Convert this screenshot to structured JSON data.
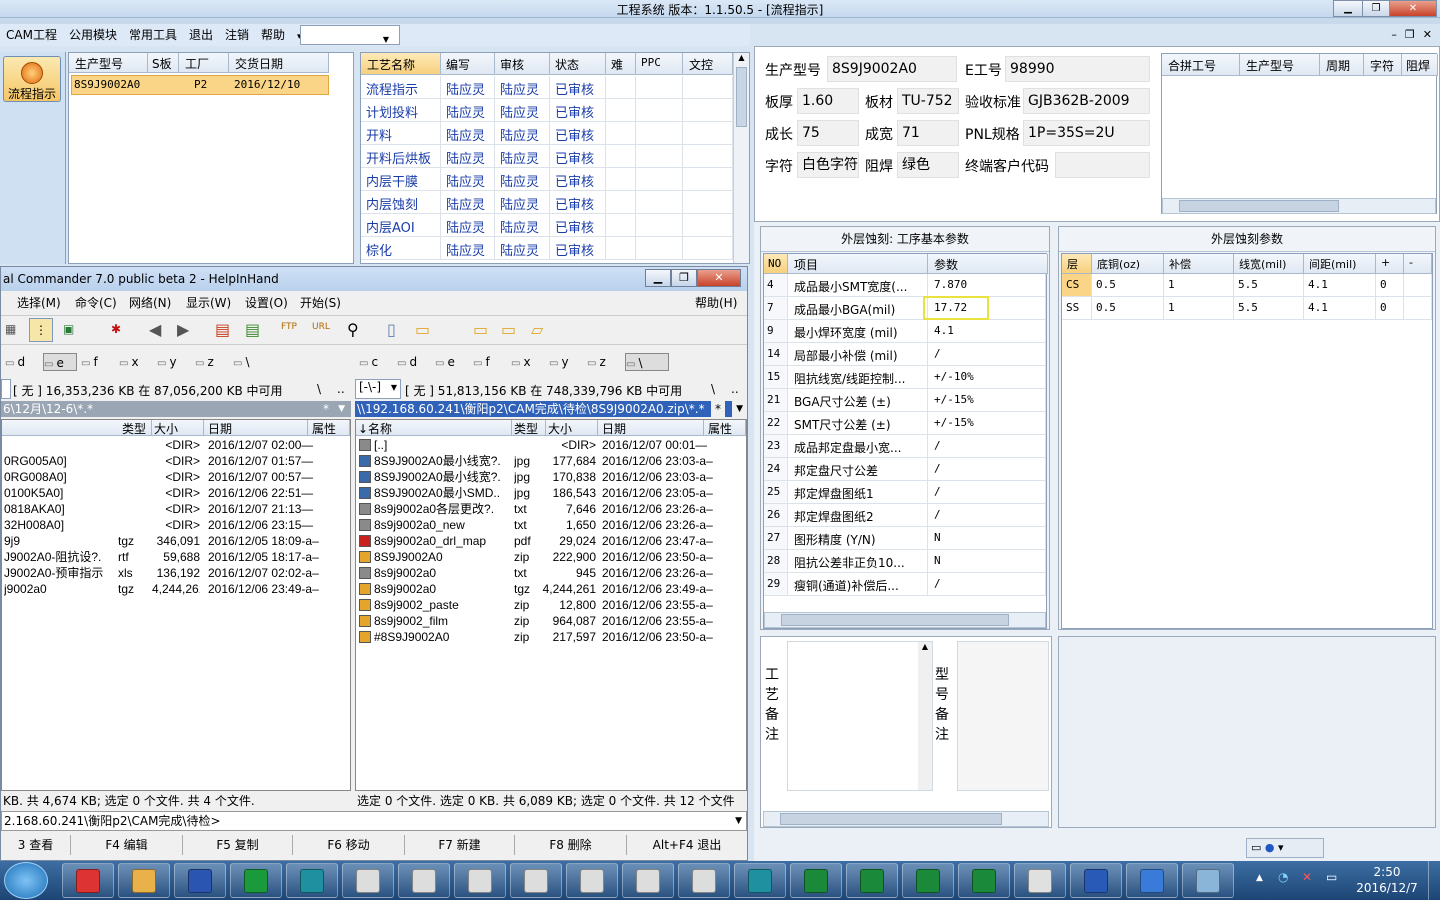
{
  "app": {
    "title": "工程系统   版本：1.1.50.5 - [流程指示]",
    "menu": [
      "CAM工程",
      "公用模块",
      "常用工具",
      "退出",
      "注销",
      "帮助"
    ],
    "flow_button": "流程指示",
    "orders": {
      "headers": [
        "生产型号",
        "S板",
        "工厂",
        "交货日期"
      ],
      "row": [
        "8S9J9002A0",
        "",
        "P2",
        "2016/12/10"
      ]
    },
    "process": {
      "headers": [
        "工艺名称",
        "编写",
        "审核",
        "状态",
        "难",
        "PPC",
        "文控"
      ],
      "rows": [
        [
          "流程指示",
          "陆应灵",
          "陆应灵",
          "已审核"
        ],
        [
          "计划投料",
          "陆应灵",
          "陆应灵",
          "已审核"
        ],
        [
          "开料",
          "陆应灵",
          "陆应灵",
          "已审核"
        ],
        [
          "开料后烘板",
          "陆应灵",
          "陆应灵",
          "已审核"
        ],
        [
          "内层干膜",
          "陆应灵",
          "陆应灵",
          "已审核"
        ],
        [
          "内层蚀刻",
          "陆应灵",
          "陆应灵",
          "已审核"
        ],
        [
          "内层AOI",
          "陆应灵",
          "陆应灵",
          "已审核"
        ],
        [
          "棕化",
          "陆应灵",
          "陆应灵",
          "已审核"
        ]
      ]
    }
  },
  "info": {
    "labels": {
      "model": "生产型号",
      "e_no": "E工号",
      "thick": "板厚",
      "mat": "板材",
      "std": "验收标准",
      "cu": "成长",
      "cw": "成宽",
      "pnl": "PNL规格",
      "char": "字符",
      "mask": "阻焊",
      "cust": "终端客户代码"
    },
    "values": {
      "model": "8S9J9002A0",
      "e_no": "98990",
      "thick": "1.60",
      "mat": "TU-752",
      "std": "GJB362B-2009",
      "cu": "75",
      "cw": "71",
      "pnl": "1P=35S=2U",
      "char": "白色字符",
      "mask": "绿色",
      "cust": ""
    },
    "merge_headers": [
      "合拼工号",
      "生产型号",
      "周期",
      "字符",
      "阻焊"
    ]
  },
  "params": {
    "title": "外层蚀刻: 工序基本参数",
    "headers": [
      "NO",
      "项目",
      "参数"
    ],
    "rows": [
      [
        "4",
        "成品最小SMT宽度(...",
        "7.870"
      ],
      [
        "7",
        "成品最小BGA(mil)",
        "17.72"
      ],
      [
        "9",
        "最小焊环宽度 (mil)",
        "4.1"
      ],
      [
        "14",
        "局部最小补偿 (mil)",
        "/"
      ],
      [
        "15",
        "阻抗线宽/线距控制...",
        "+/-10%"
      ],
      [
        "21",
        "BGA尺寸公差 (±)",
        "+/-15%"
      ],
      [
        "22",
        "SMT尺寸公差 (±)",
        "+/-15%"
      ],
      [
        "23",
        "成品邦定盘最小宽...",
        "/"
      ],
      [
        "24",
        "邦定盘尺寸公差",
        "/"
      ],
      [
        "25",
        "邦定焊盘图纸1",
        "/"
      ],
      [
        "26",
        "邦定焊盘图纸2",
        "/"
      ],
      [
        "27",
        "图形精度 (Y/N)",
        "N"
      ],
      [
        "28",
        "阻抗公差非正负10...",
        "N"
      ],
      [
        "29",
        "瘦铜(通道)补偿后...",
        "/"
      ]
    ]
  },
  "etch": {
    "title": "外层蚀刻参数",
    "headers": [
      "层",
      "底铜(oz)",
      "补偿",
      "线宽(mil)",
      "间距(mil)",
      "+",
      "-"
    ],
    "rows": [
      [
        "CS",
        "0.5",
        "1",
        "5.5",
        "4.1",
        "0"
      ],
      [
        "SS",
        "0.5",
        "1",
        "5.5",
        "4.1",
        "0"
      ]
    ]
  },
  "notes": {
    "process": "工\n艺\n备\n注",
    "model": "型\n号\n备\n注"
  },
  "tc": {
    "title": "al Commander 7.0 public beta 2 - HelpInHand",
    "menu": [
      "选择(M)",
      "命令(C)",
      "网络(N)",
      "显示(W)",
      "设置(O)",
      "开始(S)"
    ],
    "help": "帮助(H)",
    "left_drives": [
      "d",
      "e",
      "f",
      "x",
      "y",
      "z",
      "\\"
    ],
    "right_drives": [
      "c",
      "d",
      "e",
      "f",
      "x",
      "y",
      "z",
      "\\"
    ],
    "left_free": "[ 无 ]  16,353,236 KB 在 87,056,200 KB 中可用",
    "right_free": "[ 无 ]  51,813,156 KB 在 748,339,796 KB 中可用",
    "right_drive": "[-\\-]",
    "left_path": "6\\12月\\12-6\\*.*",
    "right_path": "\\\\192.168.60.241\\衡阳p2\\CAM完成\\待检\\8S9J9002A0.zip\\*.*",
    "col_headers": [
      "类型",
      "大小",
      "日期",
      "属性"
    ],
    "name_header": "↓名称",
    "left_files": [
      [
        "",
        "",
        "<DIR>",
        "2016/12/07 02:00—"
      ],
      [
        "0RG005A0]",
        "",
        "<DIR>",
        "2016/12/07 01:57—"
      ],
      [
        "0RG008A0]",
        "",
        "<DIR>",
        "2016/12/07 00:57—"
      ],
      [
        "0100K5A0]",
        "",
        "<DIR>",
        "2016/12/06 22:51—"
      ],
      [
        "0818AKA0]",
        "",
        "<DIR>",
        "2016/12/07 21:13—"
      ],
      [
        "32H008A0]",
        "",
        "<DIR>",
        "2016/12/06 23:15—"
      ],
      [
        "9j9",
        "tgz",
        "346,091",
        "2016/12/05 18:09-a–"
      ],
      [
        "J9002A0-阻抗设?.",
        "rtf",
        "59,688",
        "2016/12/05 18:17-a–"
      ],
      [
        "J9002A0-预审指示",
        "xls",
        "136,192",
        "2016/12/07 02:02-a–"
      ],
      [
        "j9002a0",
        "tgz",
        "4,244,261",
        "2016/12/06 23:49-a–"
      ]
    ],
    "right_files": [
      [
        "[..]",
        "",
        "<DIR>",
        "2016/12/07 00:01—"
      ],
      [
        "8S9J9002A0最小线宽?.",
        "jpg",
        "177,684",
        "2016/12/06 23:03-a–"
      ],
      [
        "8S9J9002A0最小线宽?.",
        "jpg",
        "170,838",
        "2016/12/06 23:03-a–"
      ],
      [
        "8S9J9002A0最小SMD..",
        "jpg",
        "186,543",
        "2016/12/06 23:05-a–"
      ],
      [
        "8s9j9002a0各层更改?.",
        "txt",
        "7,646",
        "2016/12/06 23:26-a–"
      ],
      [
        "8s9j9002a0_new",
        "txt",
        "1,650",
        "2016/12/06 23:26-a–"
      ],
      [
        "8s9j9002a0_drl_map",
        "pdf",
        "29,024",
        "2016/12/06 23:47-a–"
      ],
      [
        "8S9J9002A0",
        "zip",
        "222,900",
        "2016/12/06 23:50-a–"
      ],
      [
        "8s9j9002a0",
        "txt",
        "945",
        "2016/12/06 23:26-a–"
      ],
      [
        "8s9j9002a0",
        "tgz",
        "4,244,261",
        "2016/12/06 23:49-a–"
      ],
      [
        "8s9j9002_paste",
        "zip",
        "12,800",
        "2016/12/06 23:55-a–"
      ],
      [
        "8s9j9002_film",
        "zip",
        "964,087",
        "2016/12/06 23:55-a–"
      ],
      [
        "#8S9J9002A0",
        "zip",
        "217,597",
        "2016/12/06 23:50-a–"
      ]
    ],
    "status_left": "KB. 共 4,674 KB; 选定 0 个文件. 共 4 个文件.",
    "status_right": "选定 0 个文件. 选定 0 KB. 共 6,089 KB; 选定 0 个文件. 共 12 个文件",
    "cmd_path": "2.168.60.241\\衡阳p2\\CAM完成\\待检>",
    "fkeys": [
      "3 查看",
      "F4 编辑",
      "F5 复制",
      "F6 移动",
      "F7 新建",
      "F8 删除",
      "Alt+F4 退出"
    ]
  },
  "clock": {
    "time": "2:50",
    "date": "2016/12/7"
  }
}
